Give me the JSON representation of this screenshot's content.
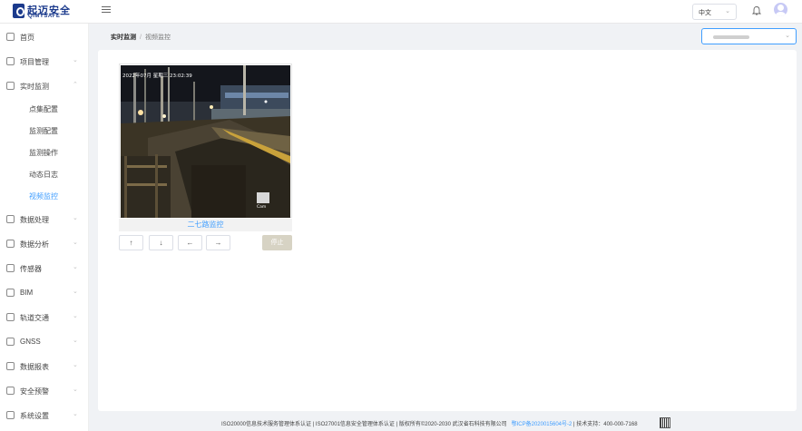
{
  "brand": {
    "name_cn": "起迈安全",
    "name_en": "QIMYSAFE"
  },
  "header": {
    "language": "中文"
  },
  "sidebar": {
    "items": [
      {
        "label": "首页",
        "icon": "home-icon",
        "expandable": false
      },
      {
        "label": "项目管理",
        "icon": "folder-icon",
        "expandable": true
      },
      {
        "label": "实时监测",
        "icon": "monitor-icon",
        "expandable": true,
        "expanded": true,
        "children": [
          {
            "label": "点集配置"
          },
          {
            "label": "监测配置"
          },
          {
            "label": "监测操作"
          },
          {
            "label": "动态日志"
          },
          {
            "label": "视频监控",
            "active": true
          }
        ]
      },
      {
        "label": "数据处理",
        "icon": "gear-icon",
        "expandable": true
      },
      {
        "label": "数据分析",
        "icon": "analysis-icon",
        "expandable": true
      },
      {
        "label": "传感器",
        "icon": "sensor-icon",
        "expandable": true
      },
      {
        "label": "BIM",
        "icon": "bim-icon",
        "expandable": true
      },
      {
        "label": "轨道交通",
        "icon": "chart-icon",
        "expandable": true
      },
      {
        "label": "GNSS",
        "icon": "gnss-icon",
        "expandable": true
      },
      {
        "label": "数据报表",
        "icon": "report-icon",
        "expandable": true
      },
      {
        "label": "安全预警",
        "icon": "alert-icon",
        "expandable": true
      },
      {
        "label": "系统设置",
        "icon": "settings-icon",
        "expandable": true
      }
    ]
  },
  "breadcrumb": {
    "parent": "实时监测",
    "separator": "/",
    "current": "视频监控"
  },
  "video": {
    "timestamp": "2022年07月  星期三 23:02:39",
    "cam_label": "Cam",
    "caption": "二七路监控",
    "controls": [
      "↑",
      "↓",
      "←",
      "→"
    ],
    "stop_label": "停止"
  },
  "footer": {
    "certs": "ISO20000信息技术服务管理体系认证 | ISO27001信息安全管理体系认证 | 版权所有©2020-2030 武汉省石科技有限公司",
    "icp": "鄂ICP备2020015604号-2",
    "support": "| 技术支持：400-000-7168"
  },
  "colors": {
    "accent": "#409eff",
    "brand": "#1b3a8c",
    "stop_button": "#d7d3c4"
  }
}
